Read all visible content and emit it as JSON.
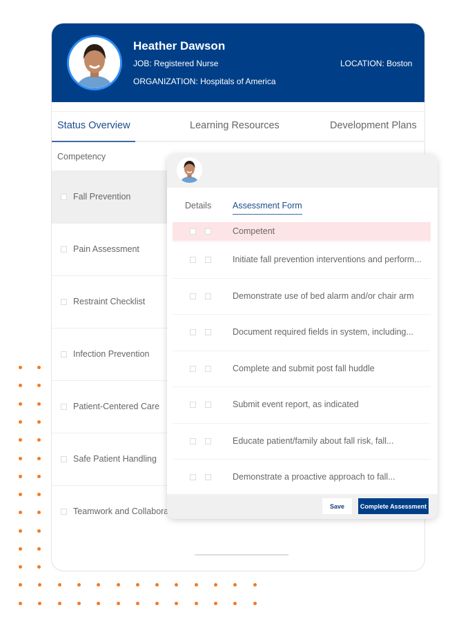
{
  "profile": {
    "name": "Heather Dawson",
    "job": "JOB: Registered Nurse",
    "organization": "ORGANIZATION: Hospitals of America",
    "location": "LOCATION: Boston"
  },
  "tabs": [
    {
      "label": "Status Overview",
      "active": true
    },
    {
      "label": "Learning Resources"
    },
    {
      "label": "Development Plans"
    }
  ],
  "competency_header": "Competency",
  "competencies": [
    "Fall Prevention",
    "Pain Assessment",
    "Restraint Checklist",
    "Infection Prevention",
    "Patient-Centered Care",
    "Safe Patient Handling",
    "Teamwork and Collabora"
  ],
  "popup": {
    "tabs": [
      {
        "label": "Details"
      },
      {
        "label": "Assessment Form",
        "active": true
      }
    ],
    "rows": [
      "Competent",
      "Initiate fall prevention interventions and perform...",
      "Demonstrate use of bed alarm and/or chair arm",
      "Document required fields in system, including...",
      "Complete and submit post fall huddle",
      "Submit event report, as indicated",
      "Educate patient/family about fall risk, fall...",
      "Demonstrate a proactive approach to fall..."
    ],
    "save_label": "Save",
    "complete_label": "Complete Assessment"
  },
  "colors": {
    "brand": "#003f87",
    "accent_dots": "#f47a20",
    "highlight": "#fde4e7"
  }
}
